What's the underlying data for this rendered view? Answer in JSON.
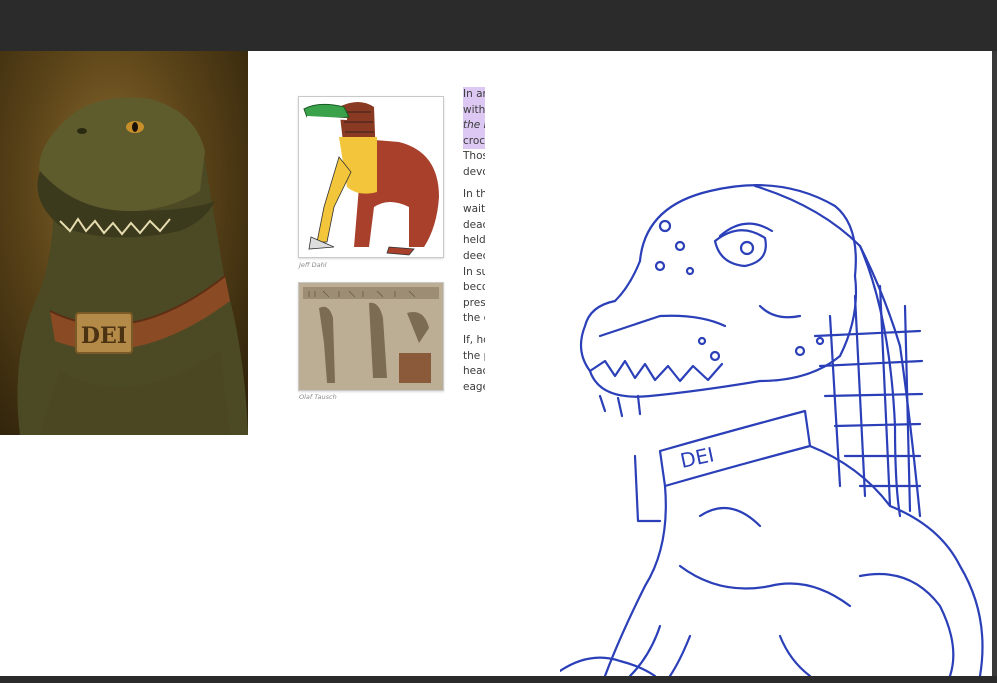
{
  "figures": [
    {
      "caption": "Jeff Dahl"
    },
    {
      "caption": "Olaf Tausch"
    }
  ],
  "article": {
    "paragraphs": [
      [
        {
          "text": "In an",
          "style": "highlight"
        },
        {
          "text": "with",
          "style": "highlight"
        },
        {
          "text": "the L",
          "style": "highlight-italic"
        },
        {
          "text": "croc",
          "style": "highlight"
        },
        {
          "text": "Thos",
          "style": "normal"
        },
        {
          "text": "devo",
          "style": "normal"
        }
      ],
      [
        {
          "text": "In th",
          "style": "normal"
        },
        {
          "text": "waite",
          "style": "normal"
        },
        {
          "text": "deac",
          "style": "normal"
        },
        {
          "text": "held",
          "style": "normal"
        },
        {
          "text": "deec",
          "style": "normal"
        },
        {
          "text": "In su",
          "style": "normal"
        },
        {
          "text": "beco",
          "style": "normal"
        },
        {
          "text": "pres",
          "style": "normal"
        },
        {
          "text": "the c",
          "style": "normal"
        }
      ],
      [
        {
          "text": "If, hc",
          "style": "normal"
        },
        {
          "text": "the p",
          "style": "normal"
        },
        {
          "text": "heac",
          "style": "normal"
        },
        {
          "text": "eage",
          "style": "normal"
        }
      ]
    ]
  },
  "portrait": {
    "collar_text": "DEI"
  },
  "sketch": {
    "collar_text": "DEI",
    "stroke_color": "#2a3fb8"
  },
  "colors": {
    "background": "#2b2b2b",
    "canvas": "#ffffff",
    "highlight": "#ddc8f3"
  }
}
